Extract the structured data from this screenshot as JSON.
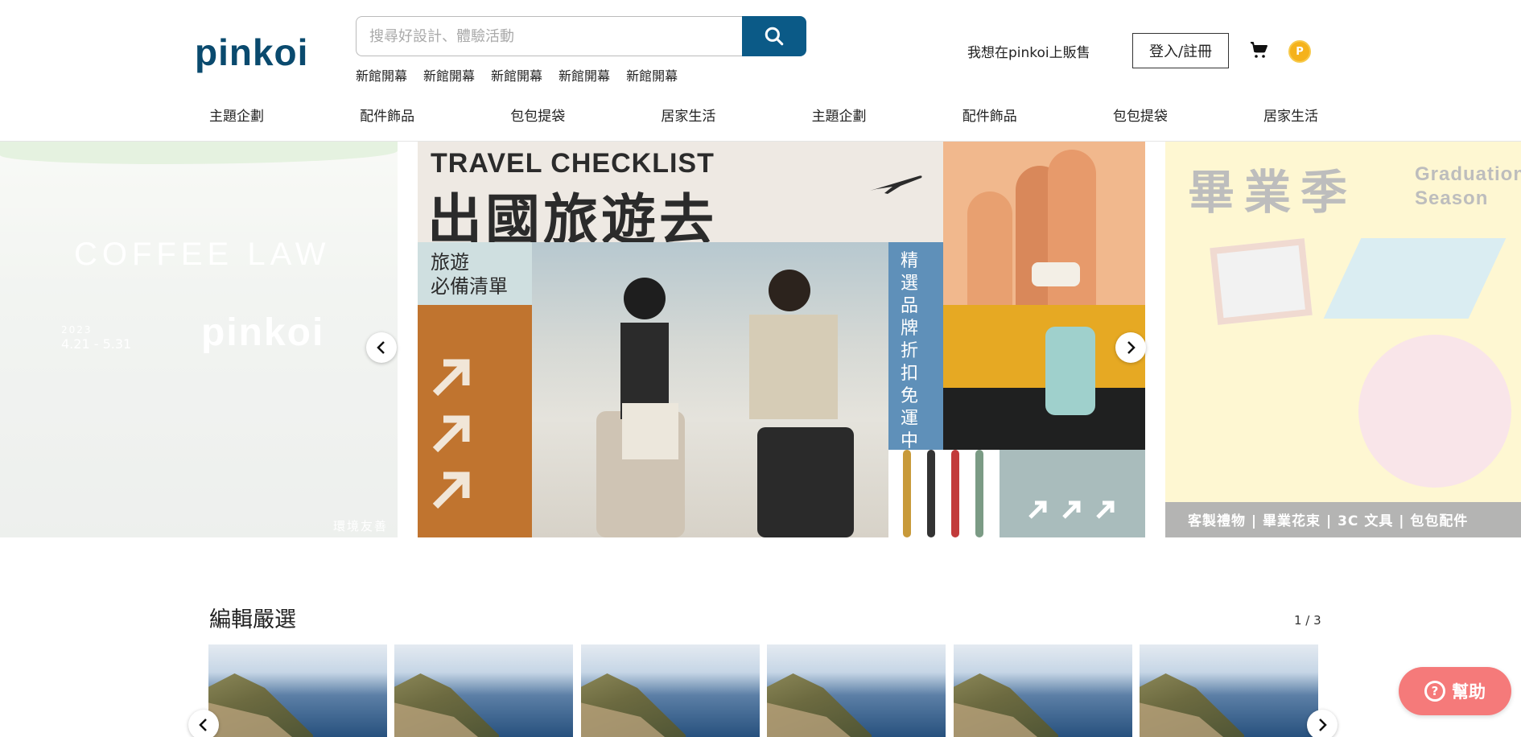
{
  "header": {
    "logo": "pinkoi",
    "search": {
      "placeholder": "搜尋好設計、體驗活動"
    },
    "hot_keywords": [
      "新館開幕",
      "新館開幕",
      "新館開幕",
      "新館開幕",
      "新館開幕"
    ],
    "sell_link": "我想在pinkoi上販售",
    "login_label": "登入/註冊",
    "coin_label": "P"
  },
  "category_nav": [
    "主題企劃",
    "配件飾品",
    "包包提袋",
    "居家生活",
    "主題企劃",
    "配件飾品",
    "包包提袋",
    "居家生活"
  ],
  "banners": {
    "left": {
      "title": "COFFEE LAW",
      "year": "2023",
      "date": "4.21 - 5.31",
      "brand": "pinkoi",
      "caption": "環境友善"
    },
    "main": {
      "title_en": "TRAVEL CHECKLIST",
      "title_zh": "出國旅遊去",
      "side_label": "旅遊\n必備清單",
      "vertical_label": "精選品牌折扣免運中"
    },
    "right": {
      "title_zh": "畢業季",
      "title_en": "Graduation\nSeason",
      "footer": "客製禮物 | 畢業花束 | 3C 文具 | 包包配件"
    }
  },
  "editor_picks": {
    "title": "編輯嚴選",
    "pager": "1 / 3",
    "items": [
      1,
      2,
      3,
      4,
      5,
      6
    ]
  },
  "help_button": "幫助",
  "colors": {
    "brand": "#0a4a6e",
    "search_button": "#0b5a87",
    "help": "#f57a7a",
    "coin": "#f5b21b"
  }
}
